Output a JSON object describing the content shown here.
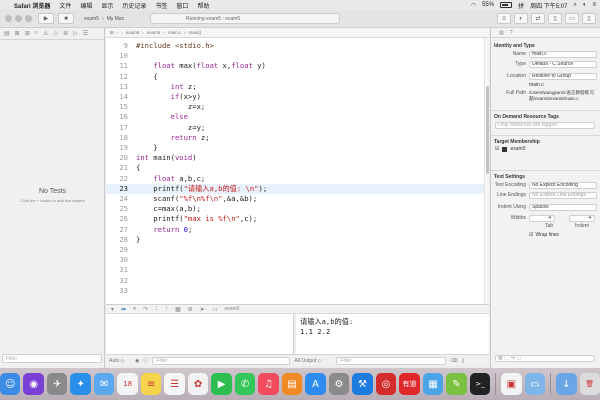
{
  "menubar": {
    "apple_glyph": "",
    "items": [
      "Safari 浏览器",
      "文件",
      "编辑",
      "显示",
      "历史记录",
      "书签",
      "窗口",
      "帮助"
    ],
    "battery": "55%",
    "input_method": "拼",
    "clock": "周四 下午5:07"
  },
  "toolbar": {
    "scheme": "exam5",
    "destination": "My Mac",
    "status": "Running exam5 : exam5",
    "run_glyph": "▶",
    "stop_glyph": "■"
  },
  "navigator": {
    "empty_title": "No Tests",
    "empty_hint": "Click the + button to add test targets",
    "filter_placeholder": "Filter"
  },
  "jumpbar": {
    "crumbs": [
      "exam5",
      "exam5",
      "main.c",
      "main()"
    ]
  },
  "editor": {
    "current_line": 23,
    "lines": [
      {
        "n": "9",
        "tokens": [
          {
            "t": "#include <stdio.h>",
            "c": "pp"
          }
        ]
      },
      {
        "n": "10",
        "tokens": []
      },
      {
        "n": "11",
        "tokens": [
          {
            "t": "    ",
            "c": "plain"
          },
          {
            "t": "float",
            "c": "kw"
          },
          {
            "t": " max(",
            "c": "plain"
          },
          {
            "t": "float",
            "c": "kw"
          },
          {
            "t": " x,",
            "c": "plain"
          },
          {
            "t": "float",
            "c": "kw"
          },
          {
            "t": " y)",
            "c": "plain"
          }
        ]
      },
      {
        "n": "12",
        "tokens": [
          {
            "t": "    {",
            "c": "plain"
          }
        ]
      },
      {
        "n": "13",
        "tokens": [
          {
            "t": "        ",
            "c": "plain"
          },
          {
            "t": "int",
            "c": "kw"
          },
          {
            "t": " z;",
            "c": "plain"
          }
        ]
      },
      {
        "n": "14",
        "tokens": [
          {
            "t": "        ",
            "c": "plain"
          },
          {
            "t": "if",
            "c": "kw"
          },
          {
            "t": "(x>y)",
            "c": "plain"
          }
        ]
      },
      {
        "n": "15",
        "tokens": [
          {
            "t": "            z=x;",
            "c": "plain"
          }
        ]
      },
      {
        "n": "16",
        "tokens": [
          {
            "t": "        ",
            "c": "plain"
          },
          {
            "t": "else",
            "c": "kw"
          }
        ]
      },
      {
        "n": "17",
        "tokens": [
          {
            "t": "            z=y;",
            "c": "plain"
          }
        ]
      },
      {
        "n": "18",
        "tokens": [
          {
            "t": "        ",
            "c": "plain"
          },
          {
            "t": "return",
            "c": "kw"
          },
          {
            "t": " z;",
            "c": "plain"
          }
        ]
      },
      {
        "n": "19",
        "tokens": [
          {
            "t": "    }",
            "c": "plain"
          }
        ]
      },
      {
        "n": "20",
        "tokens": [
          {
            "t": "int",
            "c": "kw"
          },
          {
            "t": " main(",
            "c": "plain"
          },
          {
            "t": "void",
            "c": "kw"
          },
          {
            "t": ")",
            "c": "plain"
          }
        ]
      },
      {
        "n": "21",
        "tokens": [
          {
            "t": "{",
            "c": "plain"
          }
        ]
      },
      {
        "n": "22",
        "tokens": [
          {
            "t": "    ",
            "c": "plain"
          },
          {
            "t": "float",
            "c": "kw"
          },
          {
            "t": " a,b,c;",
            "c": "plain"
          }
        ]
      },
      {
        "n": "23",
        "tokens": [
          {
            "t": "    printf(",
            "c": "plain"
          },
          {
            "t": "\"请输入a,b的值: \\n\"",
            "c": "str"
          },
          {
            "t": ");",
            "c": "plain"
          }
        ]
      },
      {
        "n": "24",
        "tokens": [
          {
            "t": "    scanf(",
            "c": "plain"
          },
          {
            "t": "\"%f\\n%f\\n\"",
            "c": "str"
          },
          {
            "t": ",&a,&b);",
            "c": "plain"
          }
        ]
      },
      {
        "n": "25",
        "tokens": [
          {
            "t": "    c=max(a,b);",
            "c": "plain"
          }
        ]
      },
      {
        "n": "26",
        "tokens": [
          {
            "t": "    printf(",
            "c": "plain"
          },
          {
            "t": "\"max is %f\\n\"",
            "c": "str"
          },
          {
            "t": ",c);",
            "c": "plain"
          }
        ]
      },
      {
        "n": "27",
        "tokens": [
          {
            "t": "    ",
            "c": "plain"
          },
          {
            "t": "return",
            "c": "kw"
          },
          {
            "t": " ",
            "c": "plain"
          },
          {
            "t": "0",
            "c": "num"
          },
          {
            "t": ";",
            "c": "plain"
          }
        ]
      },
      {
        "n": "28",
        "tokens": [
          {
            "t": "}",
            "c": "plain"
          }
        ]
      },
      {
        "n": "29",
        "tokens": []
      },
      {
        "n": "30",
        "tokens": []
      },
      {
        "n": "31",
        "tokens": []
      },
      {
        "n": "32",
        "tokens": []
      },
      {
        "n": "33",
        "tokens": []
      }
    ]
  },
  "debugbar": {
    "target": "exam5"
  },
  "console": {
    "output": "请输入a,b的值:\n1.1 2.2"
  },
  "bottombar": {
    "auto_label": "Auto ◇",
    "filter_placeholder": "Filter",
    "output_label": "All Output ◇",
    "console_filter_placeholder": "Filter"
  },
  "inspector": {
    "identity_header": "Identity and Type",
    "name_label": "Name",
    "name_value": "main.c",
    "type_label": "Type",
    "type_value": "Default - C Source",
    "location_label": "Location",
    "location_value": "Relative to Group",
    "location_file": "main.c",
    "fullpath_label": "Full Path",
    "fullpath_value": "/Users/wangjiani/c语言教程练习题/exam5/exam5/main.c",
    "odr_header": "On Demand Resource Tags",
    "odr_placeholder": "Only resources are tagged",
    "target_header": "Target Membership",
    "target_name": "exam5",
    "text_header": "Text Settings",
    "encoding_label": "Text Encoding",
    "encoding_value": "No Explicit Encoding",
    "endings_label": "Line Endings",
    "endings_value": "No Explicit Line Endings",
    "indent_label": "Indent Using",
    "indent_value": "Spaces",
    "widths_label": "Widths",
    "tab_width": "4",
    "indent_width": "4",
    "tab_caption": "Tab",
    "indent_caption": "Indent",
    "wrap_label": "Wrap lines"
  },
  "dock": {
    "apps": [
      {
        "name": "finder",
        "color": "#3c8ce6",
        "glyph": "☺"
      },
      {
        "name": "siri",
        "color": "#7a3fd6",
        "glyph": "◉"
      },
      {
        "name": "launchpad",
        "color": "#8a8a8a",
        "glyph": "✈"
      },
      {
        "name": "safari",
        "color": "#2a8fe8",
        "glyph": "✦"
      },
      {
        "name": "mail",
        "color": "#5aa8f0",
        "glyph": "✉"
      },
      {
        "name": "calendar",
        "color": "#f4f4f4",
        "glyph": "18"
      },
      {
        "name": "notes",
        "color": "#f5d34a",
        "glyph": "≡"
      },
      {
        "name": "reminders",
        "color": "#f6f6f6",
        "glyph": "☰"
      },
      {
        "name": "photos",
        "color": "#f2f2f2",
        "glyph": "✿"
      },
      {
        "name": "facetime",
        "color": "#2cbf4f",
        "glyph": "▶"
      },
      {
        "name": "messages",
        "color": "#34c759",
        "glyph": "✆"
      },
      {
        "name": "music",
        "color": "#f24b5d",
        "glyph": "♫"
      },
      {
        "name": "books",
        "color": "#f08a24",
        "glyph": "▤"
      },
      {
        "name": "app-store",
        "color": "#2d8cf0",
        "glyph": "A"
      },
      {
        "name": "system-preferences",
        "color": "#8b8b8b",
        "glyph": "⚙"
      },
      {
        "name": "xcode",
        "color": "#1e7be0",
        "glyph": "⚒"
      },
      {
        "name": "netease-music",
        "color": "#d42b2b",
        "glyph": "◎"
      },
      {
        "name": "youdao",
        "color": "#e0282b",
        "glyph": "有道"
      },
      {
        "name": "preview",
        "color": "#4ba3e8",
        "glyph": "▦"
      },
      {
        "name": "chat",
        "color": "#7ac142",
        "glyph": "✎"
      },
      {
        "name": "terminal",
        "color": "#222222",
        "glyph": ">_"
      },
      {
        "name": "preview-doc",
        "color": "#f4f4f4",
        "glyph": "▣"
      },
      {
        "name": "folder",
        "color": "#7fb6ea",
        "glyph": "▭"
      },
      {
        "name": "downloads",
        "color": "#6aa6e6",
        "glyph": "↓"
      },
      {
        "name": "trash",
        "color": "#dcdcdc",
        "glyph": "🗑"
      }
    ]
  }
}
